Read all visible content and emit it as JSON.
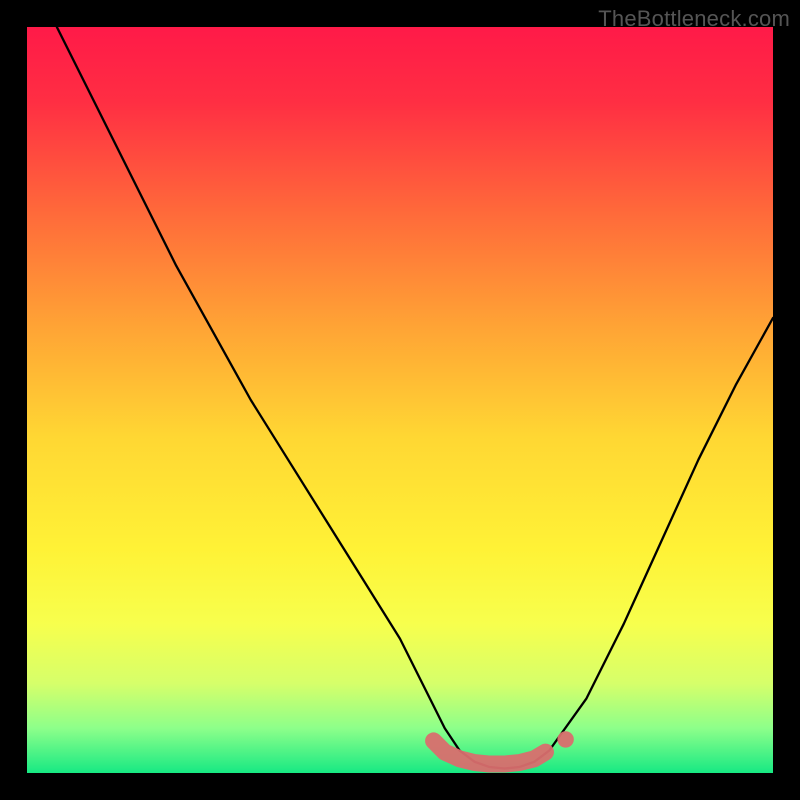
{
  "watermark": "TheBottleneck.com",
  "gradient": {
    "stops": [
      {
        "offset": 0.0,
        "color": "#ff1a48"
      },
      {
        "offset": 0.1,
        "color": "#ff2e43"
      },
      {
        "offset": 0.25,
        "color": "#ff6a3a"
      },
      {
        "offset": 0.4,
        "color": "#ffa335"
      },
      {
        "offset": 0.55,
        "color": "#ffd733"
      },
      {
        "offset": 0.7,
        "color": "#fff236"
      },
      {
        "offset": 0.8,
        "color": "#f7ff4d"
      },
      {
        "offset": 0.88,
        "color": "#d6ff6a"
      },
      {
        "offset": 0.94,
        "color": "#8dff8a"
      },
      {
        "offset": 1.0,
        "color": "#17e983"
      }
    ]
  },
  "chart_data": {
    "type": "line",
    "title": "",
    "xlabel": "",
    "ylabel": "",
    "x_range": [
      0,
      100
    ],
    "y_range": [
      0,
      100
    ],
    "series": [
      {
        "name": "bottleneck-curve",
        "x": [
          4,
          10,
          15,
          20,
          25,
          30,
          35,
          40,
          45,
          50,
          54,
          56,
          58,
          60,
          62,
          64,
          66,
          68,
          70,
          75,
          80,
          85,
          90,
          95,
          100
        ],
        "y": [
          100,
          88,
          78,
          68,
          59,
          50,
          42,
          34,
          26,
          18,
          10,
          6,
          3,
          1.5,
          0.8,
          0.6,
          0.8,
          1.5,
          3,
          10,
          20,
          31,
          42,
          52,
          61
        ]
      }
    ],
    "highlight_band": {
      "name": "optimal-range",
      "color": "#d96e6e",
      "x": [
        54.5,
        56,
        58,
        60,
        62,
        64,
        66,
        68,
        69.5
      ],
      "y": [
        4.3,
        2.8,
        1.9,
        1.4,
        1.2,
        1.2,
        1.4,
        1.9,
        2.8
      ]
    },
    "highlight_dot": {
      "x": 72.2,
      "y": 4.5,
      "r_percent": 1.1,
      "color": "#d96e6e"
    }
  }
}
